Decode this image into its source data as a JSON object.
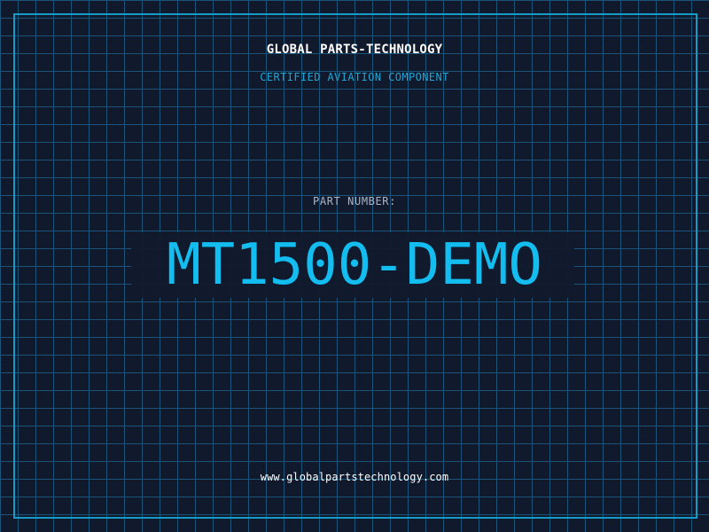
{
  "header": {
    "company_name": "GLOBAL PARTS-TECHNOLOGY",
    "subtitle": "CERTIFIED AVIATION COMPONENT"
  },
  "part": {
    "label": "PART NUMBER:",
    "number": "MT1500-DEMO"
  },
  "footer": {
    "website": "www.globalpartstechnology.com"
  },
  "colors": {
    "background": "#111a2d",
    "grid": "#1a577c",
    "frame": "#169ac6",
    "accent": "#14bdf0",
    "secondary_accent": "#21a5d3",
    "label_gray": "#aab6c8",
    "white": "#ffffff"
  }
}
